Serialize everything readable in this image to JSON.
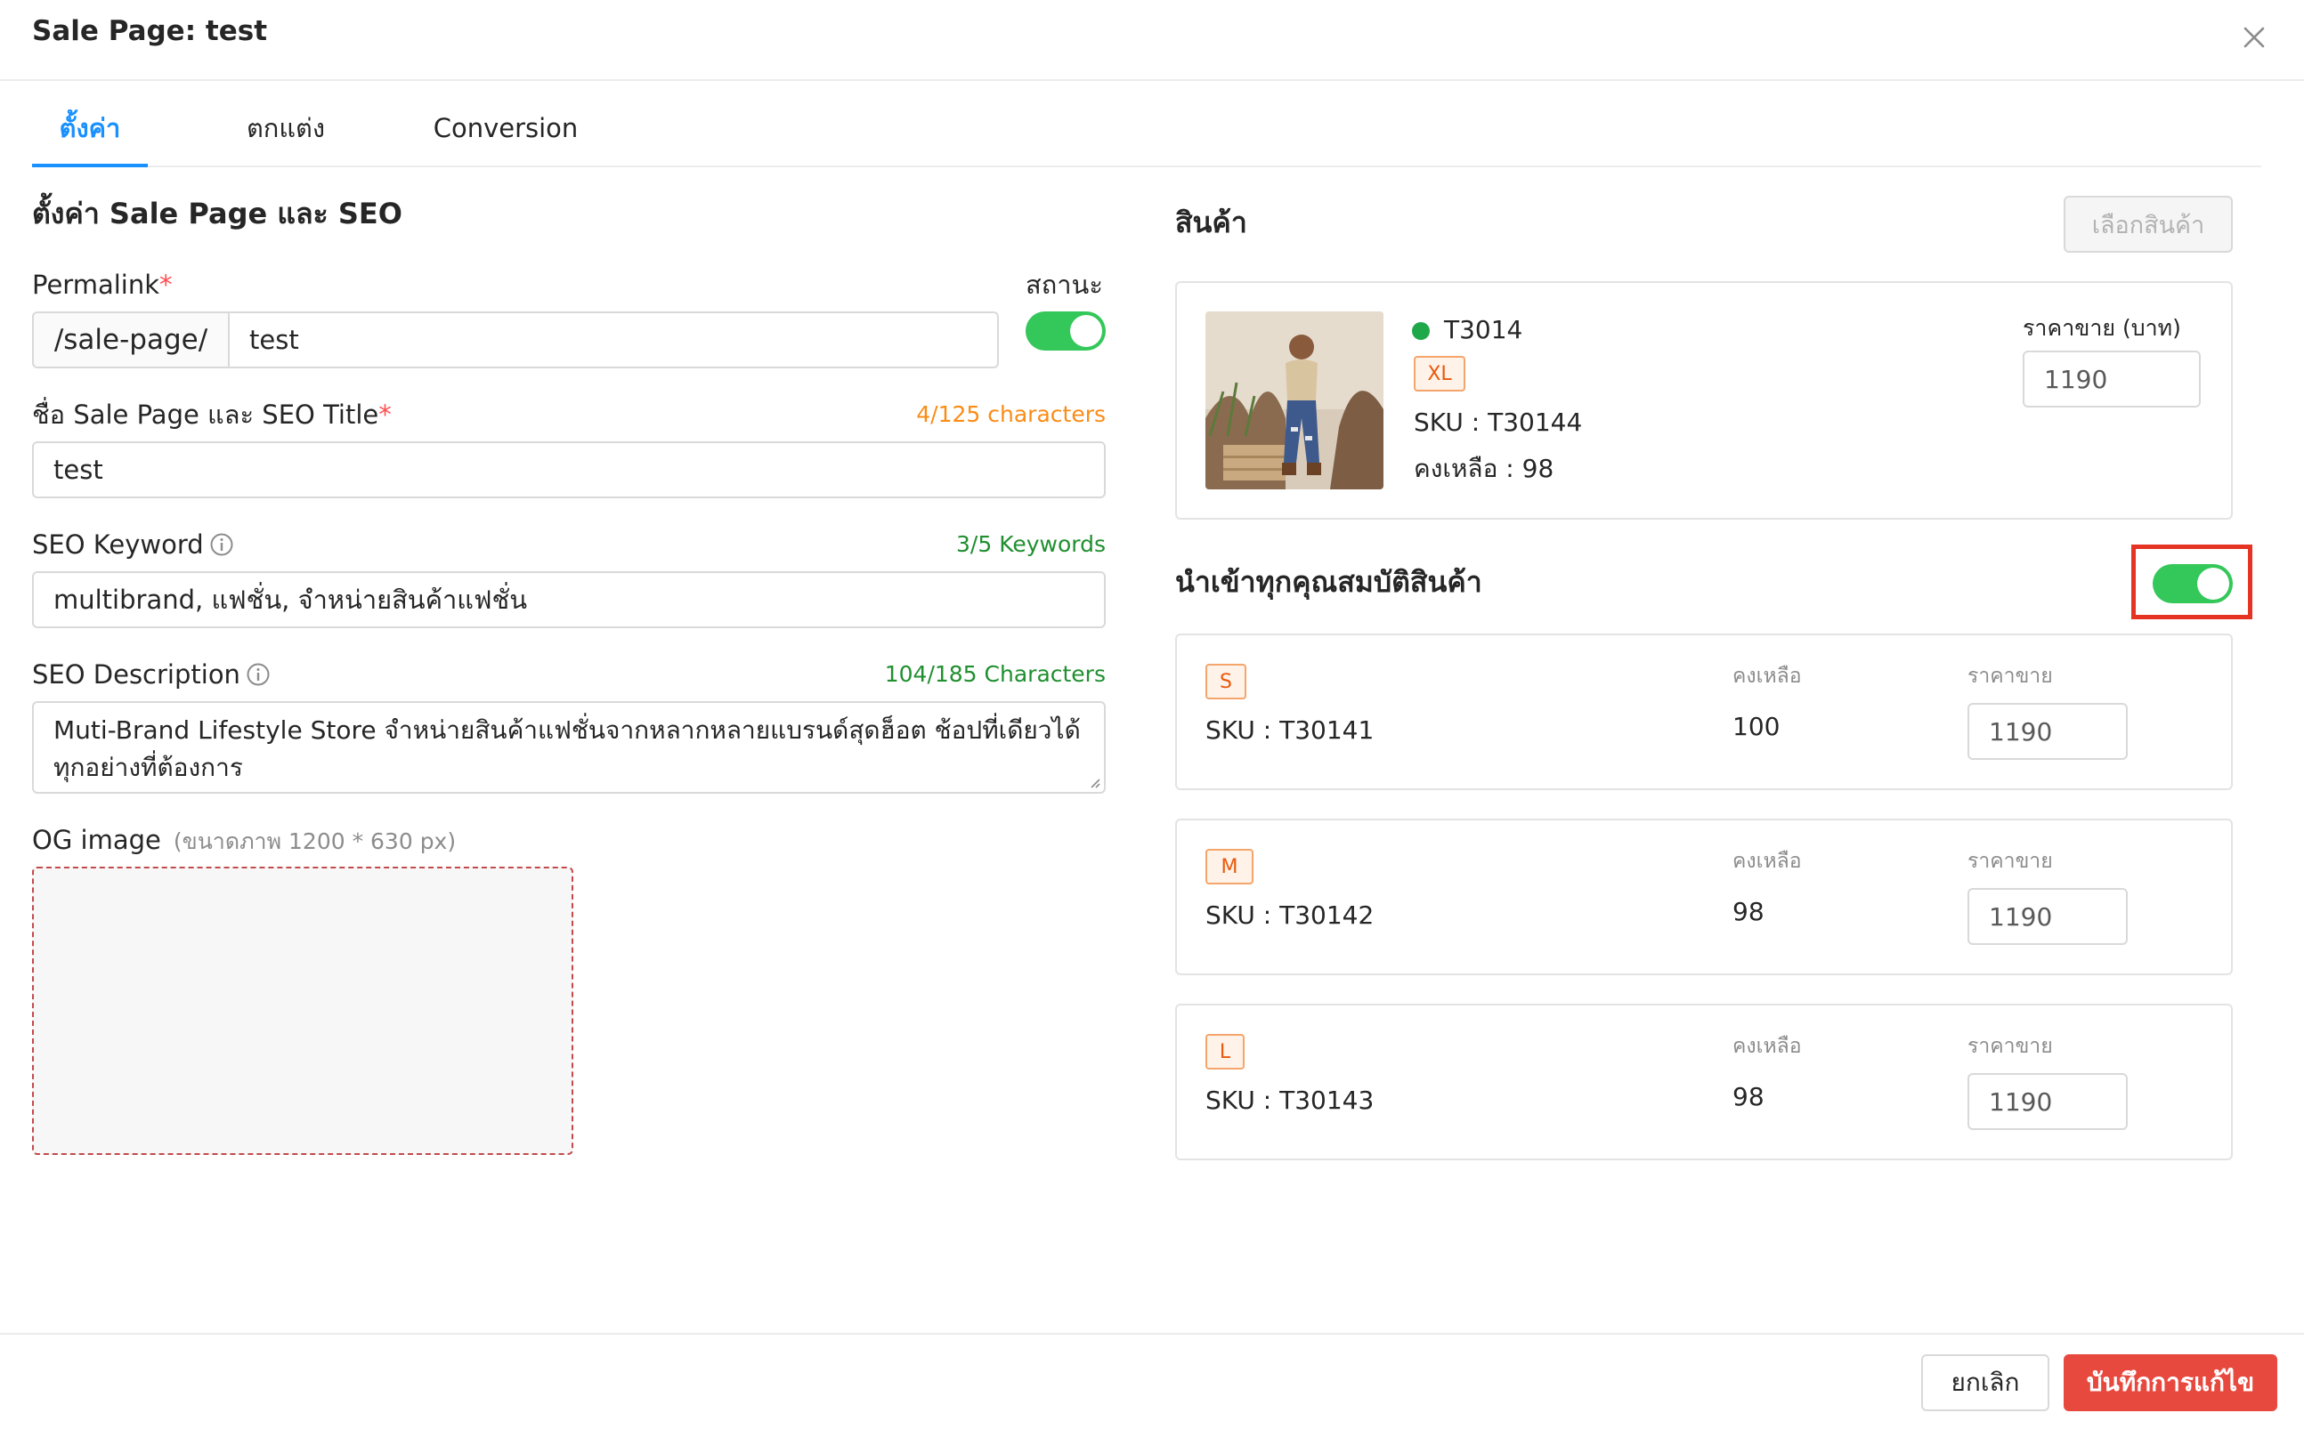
{
  "header": {
    "title": "Sale Page: test"
  },
  "tabs": [
    {
      "label": "ตั้งค่า"
    },
    {
      "label": "ตกแต่ง"
    },
    {
      "label": "Conversion"
    }
  ],
  "settings": {
    "section_title": "ตั้งค่า Sale Page และ SEO",
    "permalink": {
      "label": "Permalink",
      "required_mark": "*",
      "prefix": "/sale-page/",
      "value": "test"
    },
    "status": {
      "label": "สถานะ",
      "enabled": true
    },
    "seo_title": {
      "label": "ชื่อ Sale Page และ SEO Title",
      "required_mark": "*",
      "counter": "4/125 characters",
      "value": "test"
    },
    "seo_keyword": {
      "label": "SEO Keyword",
      "counter": "3/5 Keywords",
      "value": "multibrand, แฟชั่น, จำหน่ายสินค้าแฟชั่น"
    },
    "seo_description": {
      "label": "SEO Description",
      "counter": "104/185 Characters",
      "value": "Muti-Brand Lifestyle Store จำหน่ายสินค้าแฟชั่นจากหลากหลายแบรนด์สุดฮ็อต ช้อปที่เดียวได้ทุกอย่างที่ต้องการ"
    },
    "og_image": {
      "label": "OG image",
      "hint": "(ขนาดภาพ 1200 * 630 px)"
    }
  },
  "products": {
    "section_title": "สินค้า",
    "select_button": "เลือกสินค้า",
    "item": {
      "name": "T3014",
      "size": "XL",
      "sku": "SKU : T30144",
      "stock": "คงเหลือ : 98",
      "price_label": "ราคาขาย (บาท)",
      "price": "1190",
      "status_color": "#1fa84a"
    },
    "import_all": {
      "label": "นำเข้าทุกคุณสมบัติสินค้า",
      "enabled": true
    },
    "variants": [
      {
        "size": "S",
        "sku": "SKU : T30141",
        "stock_label": "คงเหลือ",
        "stock": "100",
        "price_label": "ราคาขาย",
        "price": "1190"
      },
      {
        "size": "M",
        "sku": "SKU : T30142",
        "stock_label": "คงเหลือ",
        "stock": "98",
        "price_label": "ราคาขาย",
        "price": "1190"
      },
      {
        "size": "L",
        "sku": "SKU : T30143",
        "stock_label": "คงเหลือ",
        "stock": "98",
        "price_label": "ราคาขาย",
        "price": "1190"
      }
    ]
  },
  "footer": {
    "cancel": "ยกเลิก",
    "save": "บันทึกการแก้ไข"
  },
  "colors": {
    "accent": "#1890ff",
    "toggle_on": "#34c759",
    "save_button": "#e8493f",
    "highlight": "#e53424"
  }
}
